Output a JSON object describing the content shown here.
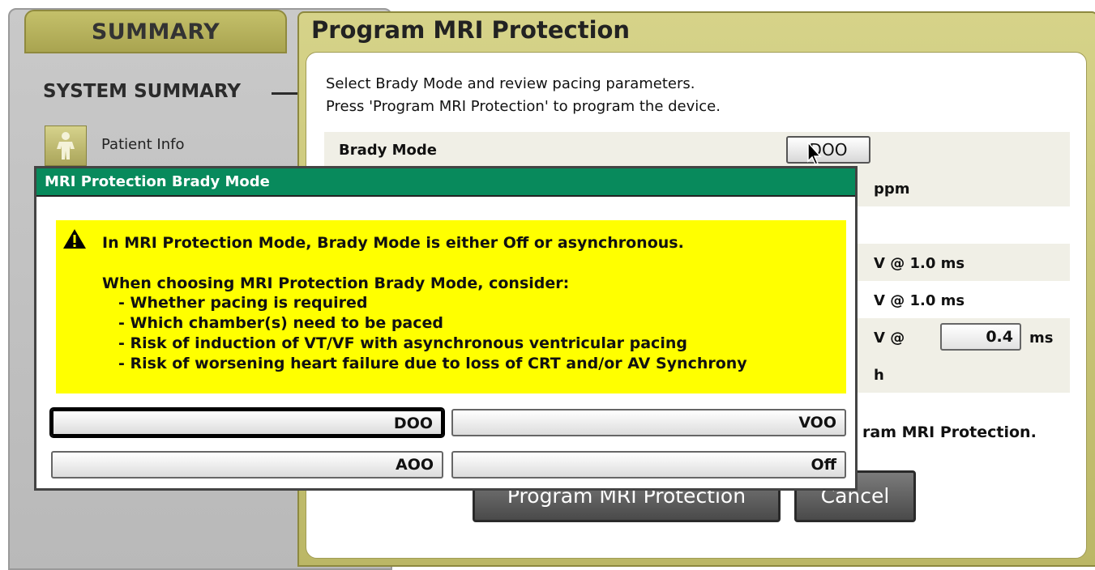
{
  "summary": {
    "tab_label": "SUMMARY",
    "heading": "SYSTEM SUMMARY",
    "patient_info_label": "Patient Info"
  },
  "mri_dialog": {
    "title": "Program MRI Protection",
    "instruction_line1": "Select Brady Mode and review pacing parameters.",
    "instruction_line2": "Press 'Program MRI Protection' to program the device.",
    "brady_mode_label": "Brady Mode",
    "brady_mode_value": "DOO",
    "units": {
      "rate": "ppm",
      "amp1": "V @ 1.0 ms",
      "amp2": "V @ 1.0 ms",
      "amp3_prefix": "V @",
      "amp3_suffix": "ms",
      "timeout": "h"
    },
    "pulse_width_value": "0.4",
    "partial_footer_text": "ram MRI Protection.",
    "program_button": "Program MRI Protection",
    "cancel_button": "Cancel"
  },
  "brady_popup": {
    "title": "MRI Protection Brady Mode",
    "warning_main": "In MRI Protection Mode, Brady Mode is either Off or asynchronous.",
    "consider_heading": "When choosing MRI Protection Brady Mode, consider:",
    "considerations": [
      "- Whether pacing is required",
      "- Which chamber(s) need to be paced",
      "- Risk of induction of VT/VF with asynchronous ventricular pacing",
      "- Risk of worsening heart failure due to loss of CRT and/or AV Synchrony"
    ],
    "options": [
      "DOO",
      "VOO",
      "AOO",
      "Off"
    ],
    "selected_option": "DOO"
  },
  "colors": {
    "popup_title_bg": "#088a5c",
    "warning_bg": "#ffff00",
    "dialog_frame": "#bbb766"
  },
  "icons": [
    "person-icon",
    "warning-triangle-icon",
    "mouse-pointer-icon"
  ]
}
